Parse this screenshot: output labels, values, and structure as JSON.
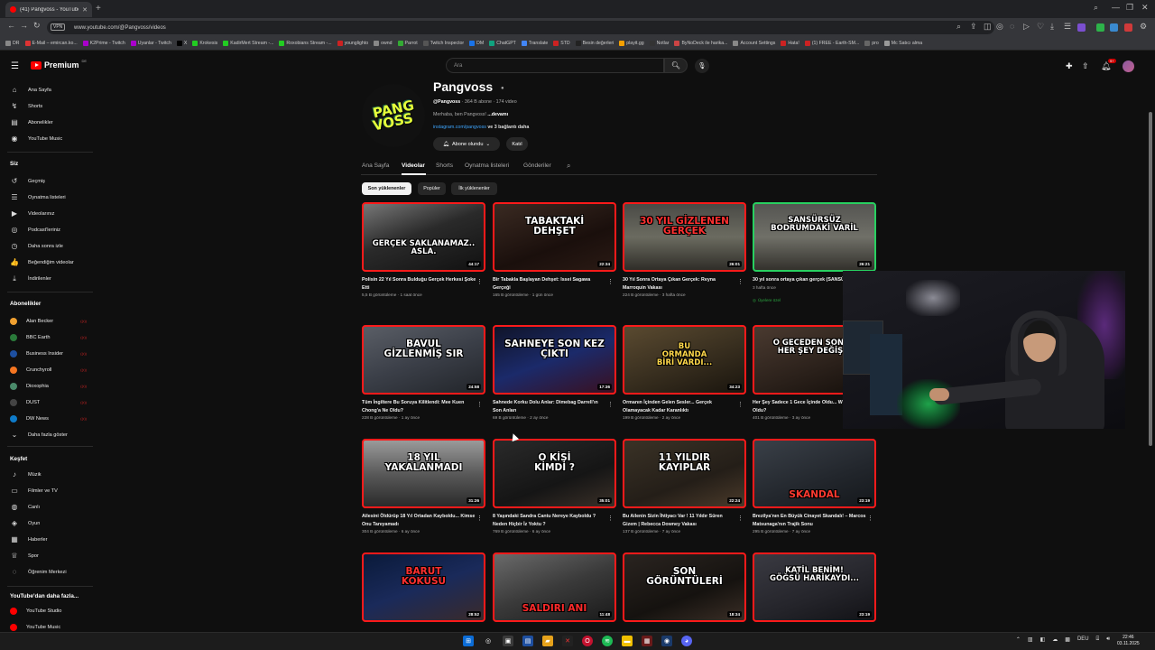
{
  "browser": {
    "tab_title": "(41) Pangvoss - YouTube",
    "url": "www.youtube.com/@Pangvoss/videos",
    "vpn": "VPN",
    "bookmarks": [
      "DR",
      "E-Mail – emircan.ko...",
      "K2Prime - Twitch",
      "Uyanlar - Twitch",
      "X",
      "Krokesis",
      "KadirMert Stream -...",
      "Roxobians Stream -...",
      "younglighto",
      "ownd",
      "Parrot",
      "Twitch Inspector",
      "DM",
      "ChatGPT",
      "Translate",
      "STD",
      "Besin değerleri",
      "playit.gg",
      "Notlar",
      "ByNoDeck ile harika...",
      "Account Settings",
      "Hata!",
      "(1) FREE - Earth-SM...",
      "pro",
      "Mc Satıcı alma"
    ]
  },
  "header": {
    "logo": "Premium",
    "logo_cc": "DE",
    "search_placeholder": "Ara",
    "notif_count": "9+"
  },
  "sidebar": {
    "main": [
      {
        "label": "Ana Sayfa",
        "icon": "home-icon",
        "glyph": "⌂"
      },
      {
        "label": "Shorts",
        "icon": "shorts-icon",
        "glyph": "↯"
      },
      {
        "label": "Abonelikler",
        "icon": "subscriptions-icon",
        "glyph": "▤"
      },
      {
        "label": "YouTube Music",
        "icon": "music-icon",
        "glyph": "◉"
      }
    ],
    "you_heading": "Siz",
    "you": [
      {
        "label": "Geçmiş",
        "icon": "history-icon",
        "glyph": "↺"
      },
      {
        "label": "Oynatma listeleri",
        "icon": "playlists-icon",
        "glyph": "☰"
      },
      {
        "label": "Videolarınız",
        "icon": "your-videos-icon",
        "glyph": "▶"
      },
      {
        "label": "Podcast'leriniz",
        "icon": "podcasts-icon",
        "glyph": "◎"
      },
      {
        "label": "Daha sonra izle",
        "icon": "watch-later-icon",
        "glyph": "◷"
      },
      {
        "label": "Beğendiğim videolar",
        "icon": "liked-icon",
        "glyph": "👍"
      },
      {
        "label": "İndirilenler",
        "icon": "downloads-icon",
        "glyph": "⤓"
      }
    ],
    "subs_heading": "Abonelikler",
    "subs": [
      {
        "label": "Alan Becker",
        "color": "#f0a030"
      },
      {
        "label": "BBC Earth",
        "color": "#2a7a3a"
      },
      {
        "label": "Business Insider",
        "color": "#1d4fa0"
      },
      {
        "label": "Crunchyroll",
        "color": "#f47521"
      },
      {
        "label": "Dioxophia",
        "color": "#4a8a6a"
      },
      {
        "label": "DUST",
        "color": "#444444"
      },
      {
        "label": "DW News",
        "color": "#0e7bc9"
      }
    ],
    "show_more": "Daha fazla göster",
    "explore_heading": "Keşfet",
    "explore": [
      {
        "label": "Müzik",
        "icon": "music-note-icon",
        "glyph": "♪"
      },
      {
        "label": "Filmler ve TV",
        "icon": "film-icon",
        "glyph": "▭"
      },
      {
        "label": "Canlı",
        "icon": "live-icon",
        "glyph": "◍"
      },
      {
        "label": "Oyun",
        "icon": "gaming-icon",
        "glyph": "◈"
      },
      {
        "label": "Haberler",
        "icon": "news-icon",
        "glyph": "▦"
      },
      {
        "label": "Spor",
        "icon": "sports-icon",
        "glyph": "♕"
      },
      {
        "label": "Öğrenim Merkezi",
        "icon": "learning-icon",
        "glyph": "◌"
      }
    ],
    "more_heading": "YouTube'dan daha fazla...",
    "more": [
      {
        "label": "YouTube Studio",
        "color": "#ff0000"
      },
      {
        "label": "YouTube Music",
        "color": "#ff0000"
      }
    ]
  },
  "channel": {
    "avatar_text_1": "PANG",
    "avatar_text_2": "VOSS",
    "name": "Pangvoss",
    "handle": "@Pangvoss",
    "stats": "· 364 B abone · 174 video",
    "desc": "Merhaba, ben Pangvoss! ",
    "desc_more": "...devamı",
    "link": "instagram.com/pangvoss",
    "link_more": " ve 3 bağlantı daha",
    "subscribed": "Abone olundu",
    "join": "Katıl",
    "tabs": [
      "Ana Sayfa",
      "Videolar",
      "Shorts",
      "Oynatma listeleri",
      "Gönderiler"
    ],
    "active_tab": "Videolar",
    "chips": [
      "Son yüklenenler",
      "Popüler",
      "İlk yüklenenler"
    ]
  },
  "videos": [
    {
      "thumb_text": "GERÇEK SAKLANAMAZ..\nASLA.",
      "duration": "44:17",
      "title": "Polisin 22 Yıl Sonra Bulduğu Gerçek Herkesi Şoke Etti",
      "meta": "5,5 B görüntüleme · 1 saat önce",
      "bg": "linear-gradient(160deg,#777 0%,#2a2a2a 45%,#111 100%)",
      "tcolor": "#ffffff"
    },
    {
      "thumb_text": "TABAKTAKİ\nDEHŞET",
      "duration": "22:34",
      "title": "Bir Tabakla Başlayan Dehşet: Issei Sagawa Gerçeği",
      "meta": "165 B görüntüleme · 1 gün önce",
      "bg": "linear-gradient(160deg,#3a2a22 0%,#1a0f0c 60%,#2a1a14 100%)",
      "tcolor": "#ffffff"
    },
    {
      "thumb_text": "30 YIL GİZLENEN\nGERÇEK",
      "duration": "26:01",
      "title": "30 Yıl Sonra Ortaya Çıkan Gerçek: Reyna Marroquin Vakası",
      "meta": "224 B görüntüleme · 3 hafta önce",
      "bg": "linear-gradient(180deg,#4a4a46 0%,#6b6b60 50%,#2f2d28 100%)",
      "tcolor": "#ff3030"
    },
    {
      "thumb_text": "SANSÜRSÜZ\nBODRUMDAKİ VARİL",
      "duration": "26:21",
      "title": "30 yıl sonra ortaya çıkan gerçek (SANSÜRSÜZ)",
      "meta": "3 hafta önce",
      "members": "Üyelere özel",
      "green": true,
      "bg": "linear-gradient(180deg,#555552 0%,#707068 50%,#33312c 100%)",
      "tcolor": "#ffffff"
    },
    {
      "thumb_text": "BAVUL\nGİZLENMİŞ SIR",
      "duration": "24:58",
      "title": "Tüm İngiltere Bu Soruya Kilitlendi: Mee Kuen Chong'a Ne Oldu?",
      "meta": "228 B görüntüleme · 1 ay önce",
      "bg": "linear-gradient(160deg,#5a5e66 0%,#3b3f48 50%,#22252a 100%)",
      "tcolor": "#ffffff"
    },
    {
      "thumb_text": "SAHNEYE SON KEZ\nÇIKTI",
      "duration": "17:36",
      "title": "Sahnede Korku Dolu Anlar: Dimebag Darrell'ın Son Anları",
      "meta": "69 B görüntüleme · 2 ay önce",
      "bg": "linear-gradient(160deg,#101428 0%,#1b2a6a 50%,#3a1020 100%)",
      "tcolor": "#ffffff"
    },
    {
      "thumb_text": "BU\nORMANDA\nBİRİ VARDI...",
      "duration": "34:23",
      "title": "Ormanın İçinden Gelen Sesler... Gerçek Olamayacak Kadar Karanlıktı",
      "meta": "199 B görüntüleme · 2 ay önce",
      "bg": "linear-gradient(160deg,#5a4a30 0%,#3a3020 50%,#1a150e 100%)",
      "tcolor": "#ffd84a"
    },
    {
      "thumb_text": "O GECEDEN SONRA\nHER ŞEY DEĞİŞTİ",
      "duration": "",
      "title": "Her Şey Sadece 1 Gece İçinde Oldu... Wilson'a Ne Oldu?",
      "meta": "401 B görüntüleme · 3 ay önce",
      "bg": "linear-gradient(160deg,#4a3a30 0%,#2a201a 60%,#140e0a 100%)",
      "tcolor": "#ffffff"
    },
    {
      "thumb_text": "18 YIL\nYAKALANMADI",
      "duration": "31:26",
      "title": "Ailesini Öldürüp 18 Yıl Ortadan Kayboldu... Kimse Onu Tanıyamadı",
      "meta": "304 B görüntüleme · 6 ay önce",
      "bg": "linear-gradient(180deg,#9a9a9a 0%,#5a5a5a 50%,#2a2a2a 100%)",
      "tcolor": "#ffffff"
    },
    {
      "thumb_text": "O KİŞİ\nKİMDİ ?",
      "duration": "35:01",
      "title": "8 Yaşındaki Sandra Cantu Nereye Kayboldu ? Neden Hiçbir İz Yoktu ?",
      "meta": "769 B görüntüleme · 6 ay önce",
      "bg": "linear-gradient(160deg,#2a2a2a 0%,#151515 60%,#3a3028 100%)",
      "tcolor": "#ffffff"
    },
    {
      "thumb_text": "11 YILDIR\nKAYIPLAR",
      "duration": "22:24",
      "title": "Bu Ailenin Sizin İhtiyacı Var ! 11 Yıldır Süren Gizem | Rebecca Downey Vakası",
      "meta": "137 B görüntüleme · 7 ay önce",
      "bg": "linear-gradient(160deg,#3a3226 0%,#241e18 60%,#4a3a2a 100%)",
      "tcolor": "#ffffff"
    },
    {
      "thumb_text": "SKANDAL",
      "duration": "23:19",
      "title": "Brezilya'nın En Büyük Cinayet Skandalı! – Marcos Matsunaga'nın Trajik Sonu",
      "meta": "295 B görüntüleme · 7 ay önce",
      "bg": "linear-gradient(160deg,#3a4048 0%,#22262c 60%,#15181c 100%)",
      "tcolor": "#ff3a30"
    },
    {
      "thumb_text": "BARUT\nKOKUSU",
      "duration": "28:52",
      "title": "",
      "meta": "",
      "bg": "linear-gradient(160deg,#0a1a3a 0%,#1a2a5a 50%,#3a2a2a 100%)",
      "tcolor": "#ff3030"
    },
    {
      "thumb_text": "SALDIRI ANI",
      "duration": "11:48",
      "title": "",
      "meta": "",
      "bg": "linear-gradient(160deg,#6a6a6a 0%,#3a3a3a 50%,#1a1a1a 100%)",
      "tcolor": "#ff2a2a"
    },
    {
      "thumb_text": "SON\nGÖRÜNTÜLERİ",
      "duration": "18:34",
      "title": "",
      "meta": "",
      "bg": "linear-gradient(160deg,#2a2420 0%,#15120f 60%,#3a2e26 100%)",
      "tcolor": "#ffffff"
    },
    {
      "thumb_text": "KATİL BENİM!\nGÖĞSÜ HARİKAYDI...",
      "duration": "23:19",
      "title": "",
      "meta": "",
      "bg": "linear-gradient(160deg,#3a3a42 0%,#24242a 60%,#121216 100%)",
      "tcolor": "#ffffff"
    }
  ],
  "taskbar": {
    "tray_lang": "DEU",
    "time": "22:46",
    "date": "03.11.2025"
  }
}
